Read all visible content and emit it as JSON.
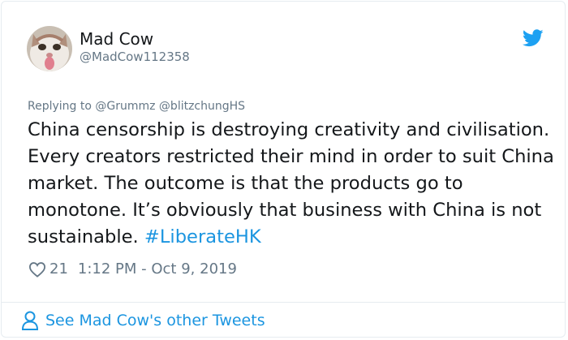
{
  "author": {
    "name": "Mad Cow",
    "handle": "@MadCow112358"
  },
  "reply_context": "Replying to @Grummz @blitzchungHS",
  "tweet": {
    "text": "China censorship is destroying creativity and civilisation. Every creators restricted their mind in order to suit China market. The outcome is that the products go to monotone. It’s obviously that business with China is not sustainable.",
    "hashtag": "#LiberateHK"
  },
  "meta": {
    "likes": "21",
    "timestamp": "1:12 PM - Oct 9, 2019"
  },
  "footer": {
    "link": "See Mad Cow's other Tweets"
  },
  "colors": {
    "link_blue": "#1b95e0",
    "twitter_blue": "#1da1f2",
    "secondary_text": "#657786",
    "primary_text": "#14171a"
  },
  "icons": [
    "cat-avatar",
    "twitter-bird-icon",
    "heart-icon",
    "person-icon"
  ]
}
